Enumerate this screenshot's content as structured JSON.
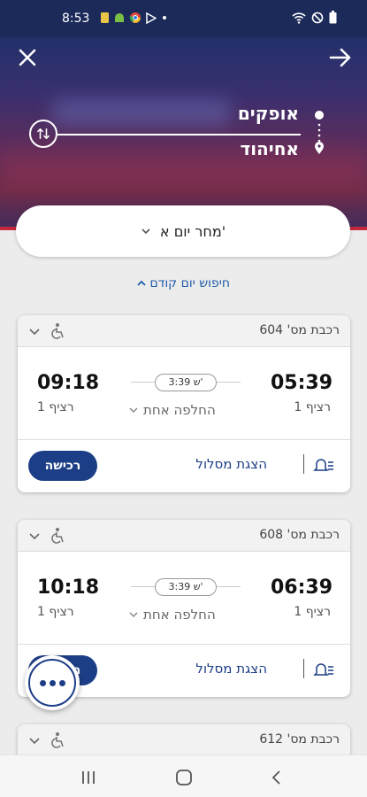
{
  "status_bar": {
    "time": "8:53"
  },
  "header": {
    "origin": "אופקים",
    "destination": "אחיהוד"
  },
  "search": {
    "date_label": "מחר יום א'",
    "previous_day_label": "חיפוש יום קודם"
  },
  "trains": [
    {
      "train_number": "רכבת מס' 604",
      "departure_time": "05:39",
      "arrival_time": "09:18",
      "departure_platform": "רציף 1",
      "arrival_platform": "רציף 1",
      "duration": "3:39 ש'",
      "changes": "החלפה אחת",
      "buy_label": "רכישה",
      "route_label": "הצגת מסלול"
    },
    {
      "train_number": "רכבת מס' 608",
      "departure_time": "06:39",
      "arrival_time": "10:18",
      "departure_platform": "רציף 1",
      "arrival_platform": "רציף 1",
      "duration": "3:39 ש'",
      "changes": "החלפה אחת",
      "buy_label": "רכישה",
      "route_label": "הצגת מסלול"
    },
    {
      "train_number": "רכבת מס' 612"
    }
  ],
  "colors": {
    "primary": "#1c3e86",
    "link": "#1f5ca8",
    "accent_red": "#c4283c"
  }
}
